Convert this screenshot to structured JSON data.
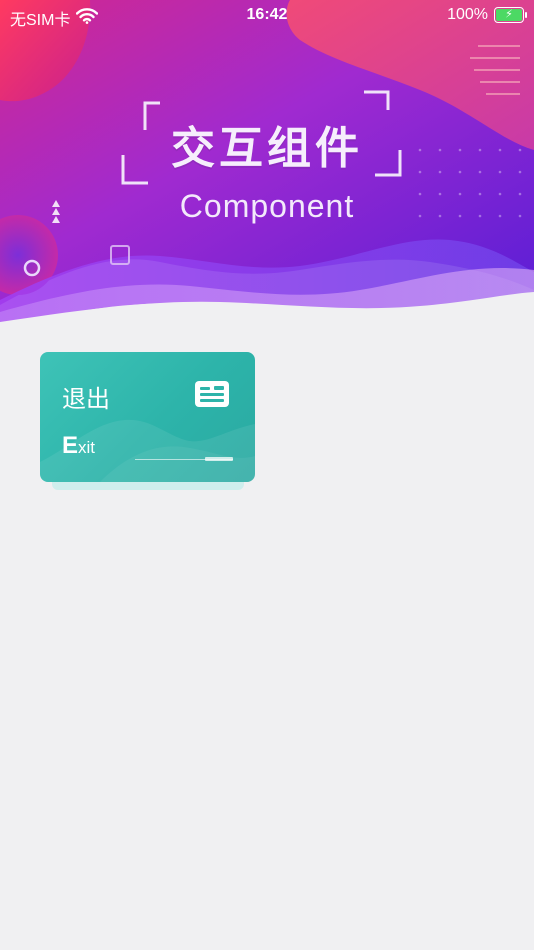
{
  "status_bar": {
    "carrier": "无SIM卡",
    "time": "16:42",
    "battery_percent": "100%",
    "battery_level": 1.0,
    "wifi_icon": "wifi-icon",
    "battery_icon": "battery-charging-icon"
  },
  "hero": {
    "title": "交互组件",
    "subtitle": "Component",
    "colors": {
      "purple_dark": "#6a1fd0",
      "magenta": "#d42f9c",
      "pink": "#f04a7a",
      "violet": "#8a3cf0"
    }
  },
  "exit_card": {
    "label_cn": "退出",
    "label_en_first": "E",
    "label_en_rest": "xit",
    "icon": "id-card-icon",
    "color": "#2db4aa"
  },
  "page": {
    "background": "#f0f0f2"
  }
}
